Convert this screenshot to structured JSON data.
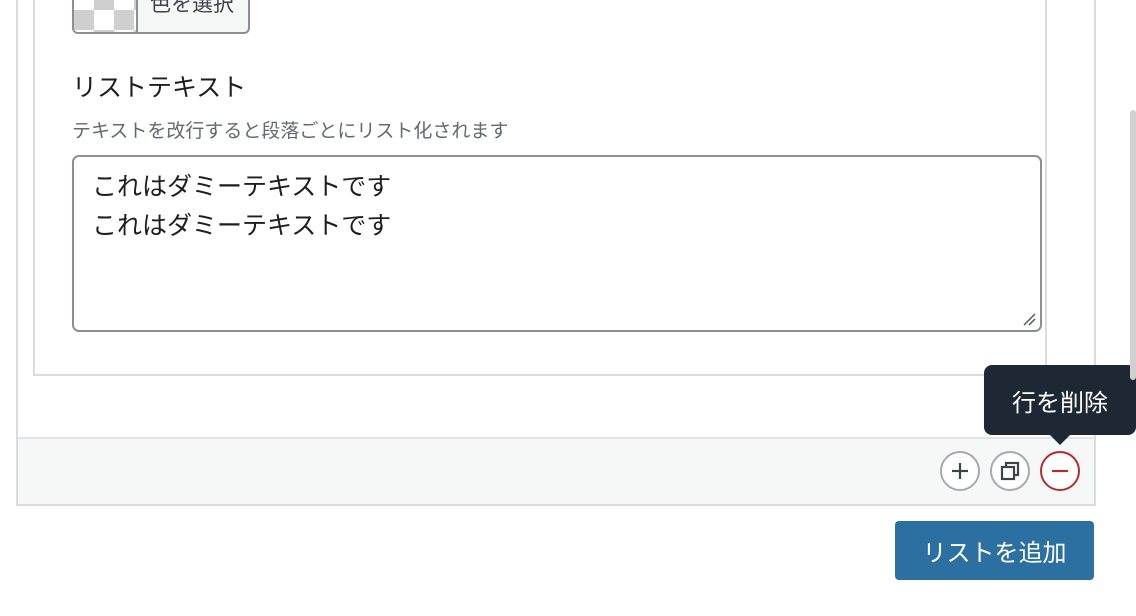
{
  "color_picker": {
    "button_label": "色を選択"
  },
  "list_field": {
    "label": "リストテキスト",
    "help": "テキストを改行すると段落ごとにリスト化されます",
    "lines": [
      "これはダミーテキストです",
      "これはダミーテキストです"
    ]
  },
  "row_actions": {
    "tooltip": "行を削除",
    "icons": [
      "plus-icon",
      "duplicate-icon",
      "minus-icon"
    ],
    "remove_color": "#b32d2e"
  },
  "footer": {
    "add_list_label": "リストを追加",
    "accent": "#2c6fa1"
  }
}
